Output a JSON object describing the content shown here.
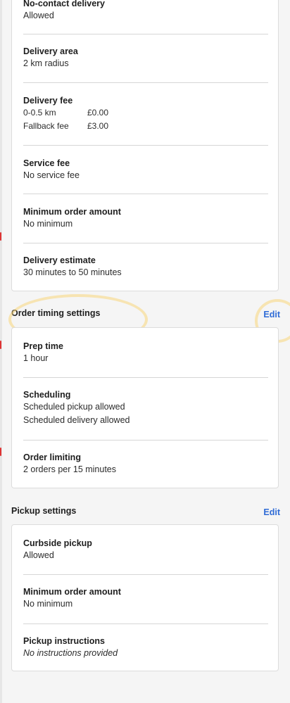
{
  "delivery_card": {
    "no_contact_title": "No-contact delivery",
    "no_contact_value": "Allowed",
    "area_title": "Delivery area",
    "area_value": "2 km radius",
    "fee_title": "Delivery fee",
    "fee_rows": [
      {
        "label": "0-0.5 km",
        "value": "£0.00"
      },
      {
        "label": "Fallback fee",
        "value": "£3.00"
      }
    ],
    "service_fee_title": "Service fee",
    "service_fee_value": "No service fee",
    "min_order_title": "Minimum order amount",
    "min_order_value": "No minimum",
    "estimate_title": "Delivery estimate",
    "estimate_value": "30 minutes to 50 minutes"
  },
  "order_timing": {
    "section_title": "Order timing settings",
    "edit_label": "Edit",
    "prep_title": "Prep time",
    "prep_value": "1 hour",
    "scheduling_title": "Scheduling",
    "scheduling_values": [
      "Scheduled pickup allowed",
      "Scheduled delivery allowed"
    ],
    "limiting_title": "Order limiting",
    "limiting_value": "2 orders per 15 minutes"
  },
  "pickup": {
    "section_title": "Pickup settings",
    "edit_label": "Edit",
    "curbside_title": "Curbside pickup",
    "curbside_value": "Allowed",
    "min_order_title": "Minimum order amount",
    "min_order_value": "No minimum",
    "instructions_title": "Pickup instructions",
    "instructions_value": "No instructions provided"
  },
  "colors": {
    "link": "#2e6bd6",
    "highlight": "#f7d67a",
    "annotation_red": "#dd3333"
  }
}
